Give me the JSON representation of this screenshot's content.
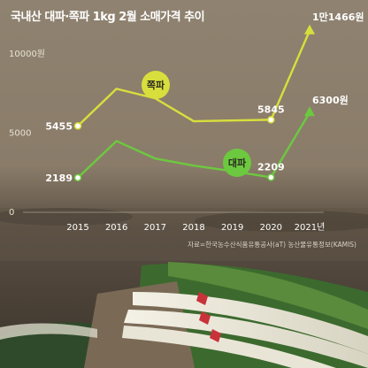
{
  "chart_data": {
    "type": "line",
    "title": "국내산 대파·쪽파 1kg 2월 소매가격 추이",
    "categories": [
      "2015",
      "2016",
      "2017",
      "2018",
      "2019",
      "2020",
      "2021년"
    ],
    "x": [
      2015,
      2016,
      2017,
      2018,
      2019,
      2020,
      2021
    ],
    "ylim": [
      0,
      12000
    ],
    "yticks": [
      "0",
      "5000",
      "10000원"
    ],
    "ytick_values": [
      0,
      5000,
      10000
    ],
    "series": [
      {
        "name": "쪽파",
        "color": "#d8df3c",
        "values": [
          5455,
          7800,
          7200,
          5750,
          5800,
          5845,
          11466
        ],
        "data_labels": [
          "5455",
          "5845",
          "1만1466원"
        ],
        "label_indices": [
          0,
          5,
          6
        ]
      },
      {
        "name": "대파",
        "color": "#6cc93f",
        "values": [
          2189,
          4500,
          3400,
          2950,
          2600,
          2209,
          6300
        ],
        "data_labels": [
          "2189",
          "2209",
          "6300원"
        ],
        "label_indices": [
          0,
          5,
          6
        ]
      }
    ],
    "source": "자료=한국농수산식품유통공사(aT) 농산물유통정보(KAMIS)",
    "grid": false,
    "legend": "inline"
  }
}
